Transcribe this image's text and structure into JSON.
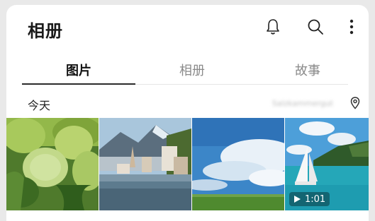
{
  "header": {
    "title": "相册",
    "icons": [
      "bell-icon",
      "search-icon",
      "more-vertical-icon"
    ]
  },
  "tabs": [
    {
      "label": "图片",
      "active": true
    },
    {
      "label": "相册",
      "active": false
    },
    {
      "label": "故事",
      "active": false
    }
  ],
  "section": {
    "label": "今天",
    "location": "Salzkammergut",
    "location_icon": "location-pin-icon"
  },
  "photos": [
    {
      "subject": "green hydrangea flowers"
    },
    {
      "subject": "lakeside village with church and mountains"
    },
    {
      "subject": "blue sky with clouds over green field"
    },
    {
      "subject": "sailboat on turquoise sea",
      "video_duration": "1:01",
      "video_icon": "play-icon"
    }
  ],
  "colors": {
    "background": "#e9e9e9",
    "card": "#ffffff",
    "active_tab": "#111111",
    "inactive_tab": "#8a8a8a"
  }
}
